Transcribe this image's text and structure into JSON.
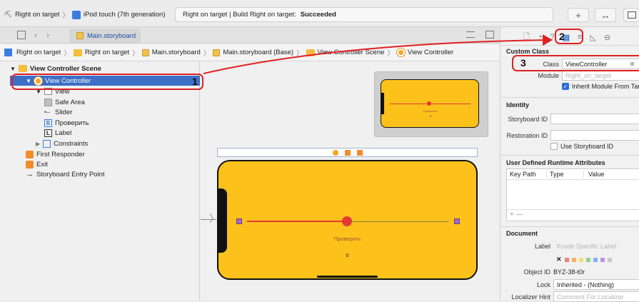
{
  "toolbar": {
    "scheme_target": "Right on target",
    "scheme_device": "iPod touch (7th generation)",
    "status_project": "Right on target | Build Right on target:",
    "status_result": "Succeeded",
    "plus": "+",
    "swap": "↔"
  },
  "tab": {
    "label": "Main.storyboard"
  },
  "breadcrumb": {
    "items": [
      "Right on target",
      "Right on target",
      "Main.storyboard",
      "Main.storyboard (Base)",
      "View Controller Scene",
      "View Controller"
    ]
  },
  "outline": {
    "items": [
      {
        "label": "View Controller Scene",
        "bold": true
      },
      {
        "label": "View Controller",
        "selected": true
      },
      {
        "label": "View"
      },
      {
        "label": "Safe Area"
      },
      {
        "label": "Slider"
      },
      {
        "label": "Проверить"
      },
      {
        "label": "Label"
      },
      {
        "label": "Constraints"
      },
      {
        "label": "First Responder"
      },
      {
        "label": "Exit"
      },
      {
        "label": "Storyboard Entry Point"
      }
    ]
  },
  "canvas": {
    "button_title": "Проверить",
    "label_text": "0"
  },
  "inspector": {
    "custom_class": {
      "title": "Custom Class",
      "class_label": "Class",
      "class_value": "ViewController",
      "module_label": "Module",
      "module_placeholder": "Right_on_target",
      "inherit": "Inherit Module From Target"
    },
    "identity": {
      "title": "Identity",
      "storyboard_id": "Storyboard ID",
      "restoration_id": "Restoration ID",
      "use_storyboard_id": "Use Storyboard ID"
    },
    "runtime": {
      "title": "User Defined Runtime Attributes",
      "col_key": "Key Path",
      "col_type": "Type",
      "col_value": "Value",
      "add": "+ —"
    },
    "document": {
      "title": "Document",
      "label_label": "Label",
      "label_placeholder": "Xcode Specific Label",
      "object_id_label": "Object ID",
      "object_id": "BYZ-38-t0r",
      "lock_label": "Lock",
      "lock_value": "Inherited - (Nothing)",
      "localizer_label": "Localizer Hint",
      "localizer_placeholder": "Comment For Localizer"
    }
  },
  "annotations": {
    "n1": "1",
    "n2": "2",
    "n3": "3"
  },
  "colors": {
    "accent": "#fcc21b",
    "selection": "#3c6fc6",
    "annotation": "#e02020"
  }
}
